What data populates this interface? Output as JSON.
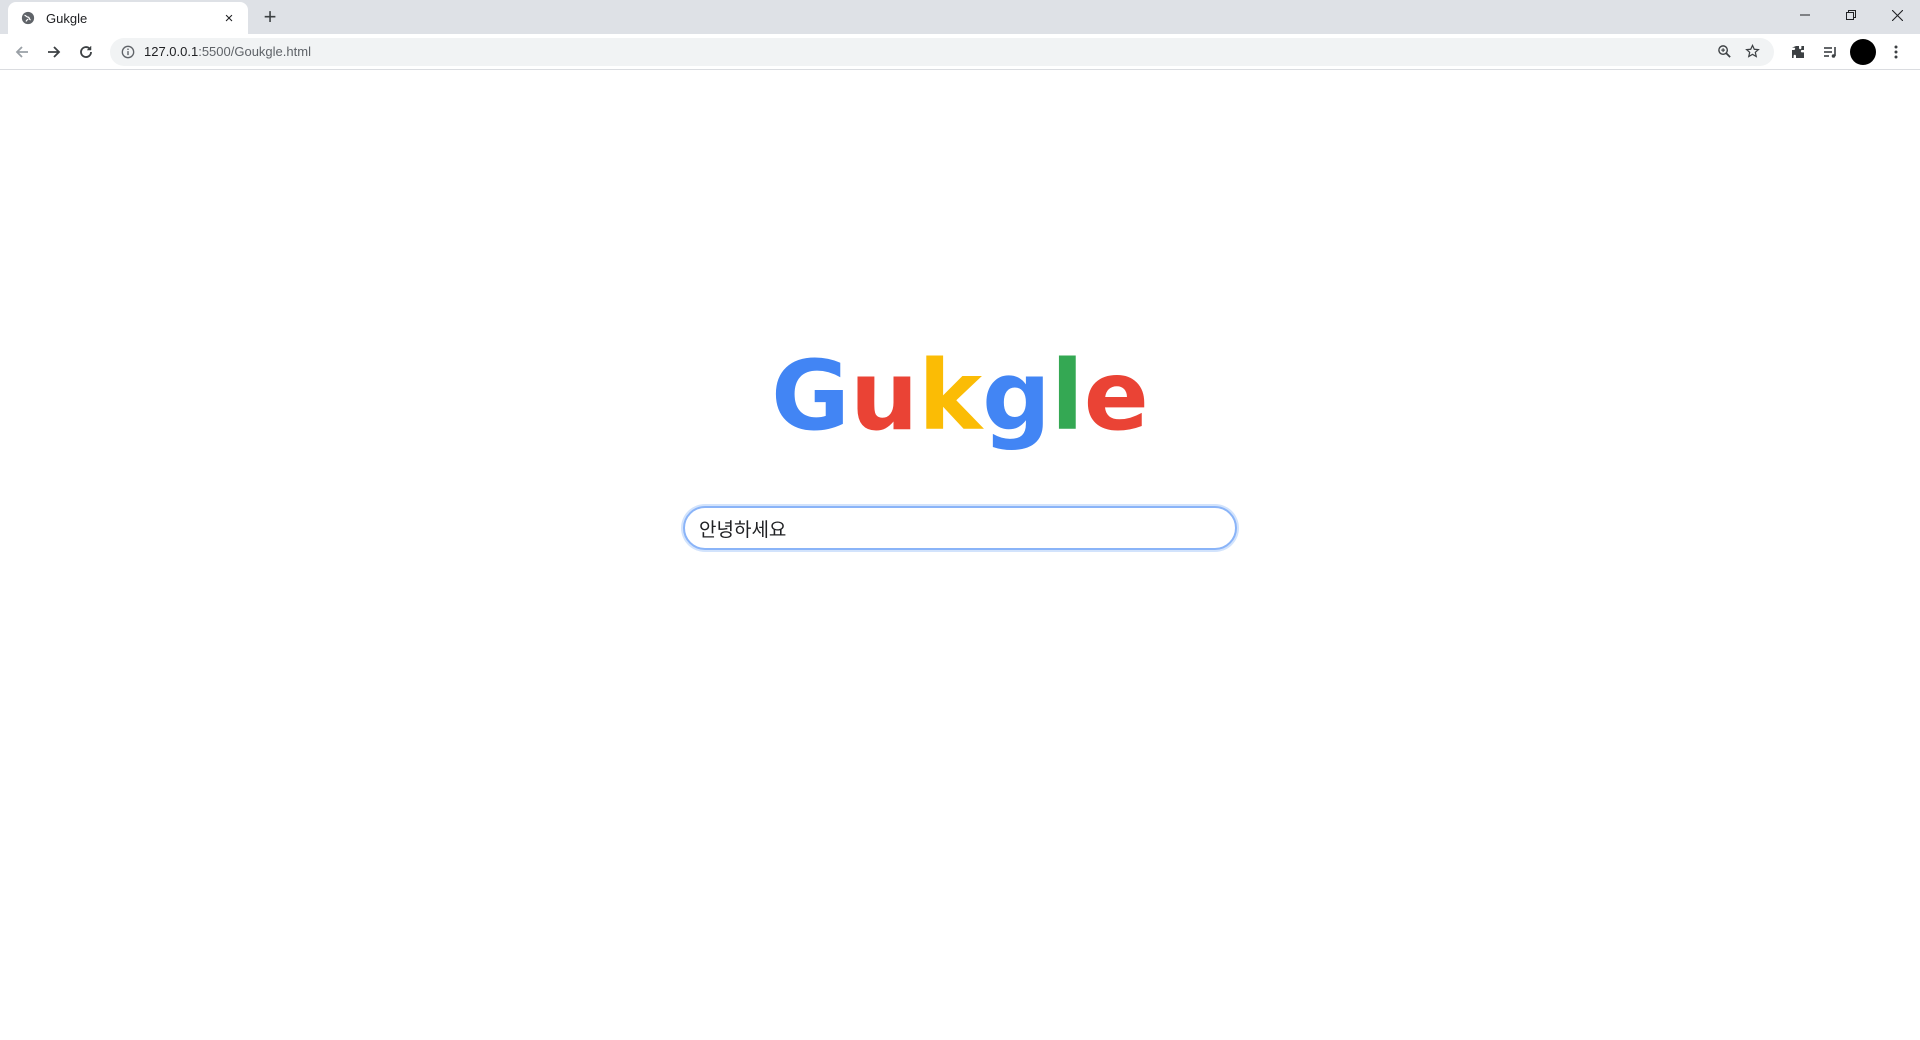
{
  "tab": {
    "title": "Gukgle",
    "favicon": "globe-icon",
    "close": "×"
  },
  "new_tab": "+",
  "toolbar": {
    "url_host": "127.0.0.1",
    "url_path": ":5500/Goukgle.html"
  },
  "logo": {
    "letters": [
      {
        "char": "G",
        "color": "#4285f4"
      },
      {
        "char": "u",
        "color": "#ea4335"
      },
      {
        "char": "k",
        "color": "#fbbc05"
      },
      {
        "char": "g",
        "color": "#4285f4"
      },
      {
        "char": "l",
        "color": "#34a853"
      },
      {
        "char": "e",
        "color": "#ea4335"
      }
    ]
  },
  "search": {
    "value": "안녕하세요"
  }
}
